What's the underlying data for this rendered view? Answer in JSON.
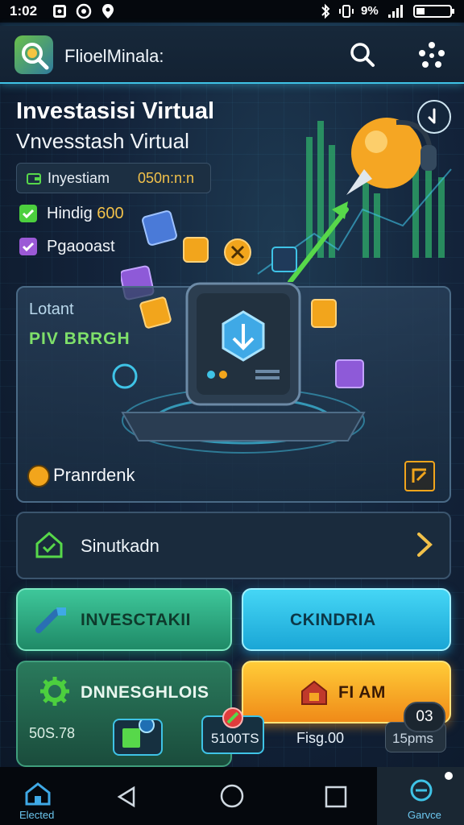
{
  "status_bar": {
    "time": "1:02",
    "battery_text": "9%",
    "icons": [
      "image-icon",
      "at-icon",
      "location-icon",
      "bluetooth-icon",
      "vibrate-icon",
      "signal-icon",
      "battery-icon"
    ]
  },
  "header": {
    "title": "FlioelMinala:",
    "logo_icon": "magnifier-plant-logo",
    "search_icon": "search-icon",
    "menu_icon": "apps-icon"
  },
  "hero": {
    "title": "Investasisi Virtual",
    "subtitle": "Vnvesstash Virtual",
    "stat_label": "Inyestiam",
    "stat_value": "050n:n:n",
    "check_1_label": "Hindig",
    "check_1_value": "600",
    "check_2_label": "Pgaooast"
  },
  "holo_card": {
    "label": "Lotant",
    "status": "PIV BRRGH",
    "footer_label": "Pranrdenk"
  },
  "list_row": {
    "label": "Sinutkadn"
  },
  "actions": {
    "primary_label": "INVESCTAKII",
    "secondary_label": "CKINDRIA",
    "tertiary_label": "DNNESGHLOIS",
    "cta_label": "FI AM"
  },
  "chips": {
    "balance": "50S.78",
    "stocks": "5100TS",
    "flag_text": "Fisg.00",
    "badge_count": "03",
    "time_text": "15pms"
  },
  "nav": {
    "home_label": "Elected",
    "profile_label": "Garvce"
  },
  "colors": {
    "accent_cyan": "#3fc3e6",
    "accent_green": "#3ec79a",
    "accent_orange": "#f5a623",
    "value_yellow": "#f2c14a"
  }
}
